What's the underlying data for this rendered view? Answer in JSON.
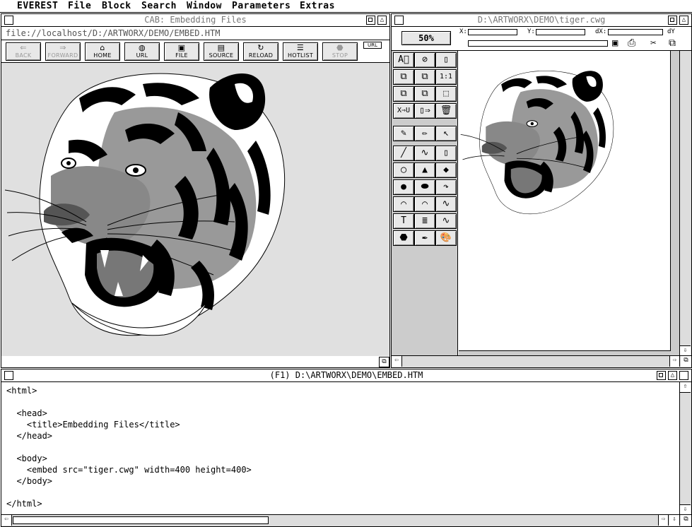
{
  "menubar": {
    "items": [
      "EVEREST",
      "File",
      "Block",
      "Search",
      "Window",
      "Parameters",
      "Extras"
    ]
  },
  "browser_window": {
    "title": "CAB: Embedding Files",
    "url": "file://localhost/D:/ARTWORX/DEMO/EMBED.HTM",
    "url_button": "URL",
    "toolbar": [
      {
        "label": "BACK",
        "icon": "back-arrow-icon",
        "enabled": false
      },
      {
        "label": "FORWARD",
        "icon": "forward-arrow-icon",
        "enabled": false
      },
      {
        "label": "HOME",
        "icon": "home-icon",
        "enabled": true
      },
      {
        "label": "URL",
        "icon": "globe-icon",
        "enabled": true
      },
      {
        "label": "FILE",
        "icon": "disk-icon",
        "enabled": true
      },
      {
        "label": "SOURCE",
        "icon": "document-icon",
        "enabled": true
      },
      {
        "label": "RELOAD",
        "icon": "reload-icon",
        "enabled": true
      },
      {
        "label": "HOTLIST",
        "icon": "hotlist-icon",
        "enabled": true
      },
      {
        "label": "STOP",
        "icon": "stop-icon",
        "enabled": false
      }
    ]
  },
  "drawing_window": {
    "title": "D:\\ARTWORX\\DEMO\\tiger.cwg",
    "zoom": "50%",
    "fields": {
      "x_label": "X:",
      "y_label": "Y:",
      "dx_label": "dX:",
      "dy_label": "dY"
    },
    "tools": [
      "A⃝",
      "⊘",
      "▯",
      "⧉",
      "⧉",
      "1:1",
      "⧉",
      "⧉",
      "⬚",
      "X⇒U",
      "▯⇒",
      "🗑",
      "✎",
      "✏",
      "↖",
      "╱",
      "∿",
      "▯",
      "◯",
      "▲",
      "◆",
      "●",
      "⬬",
      "↷",
      "⌒",
      "⌒",
      "∿",
      "T",
      "≣",
      "∿",
      "⬣",
      "✒",
      "🎨"
    ]
  },
  "source_window": {
    "title": "(F1) D:\\ARTWORX\\DEMO\\EMBED.HTM",
    "lines": [
      "<html>",
      "",
      "  <head>",
      "    <title>Embedding Files</title>",
      "  </head>",
      "",
      "  <body>",
      "    <embed src=\"tiger.cwg\" width=400 height=400>",
      "  </body>",
      "",
      "</html>"
    ]
  },
  "colors": {
    "desktop": "#ffffff",
    "gray_panel": "#e0e0e0",
    "scroll": "#dddddd"
  }
}
